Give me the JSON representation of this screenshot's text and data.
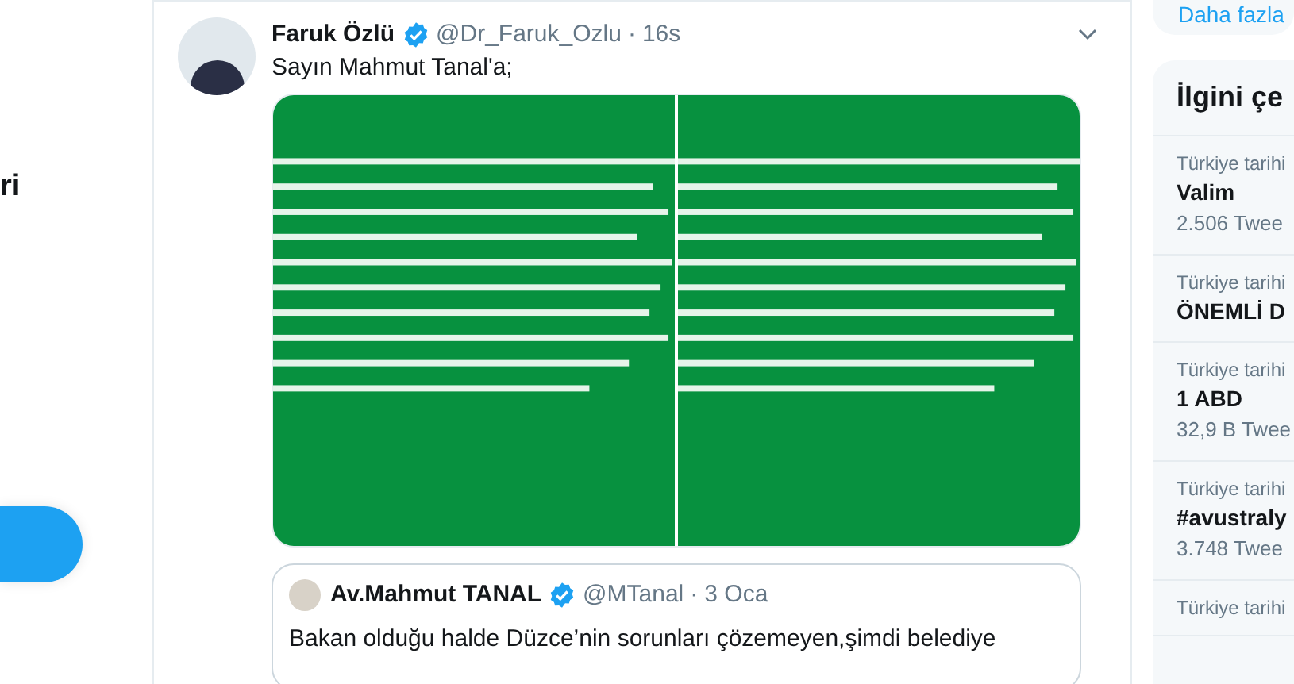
{
  "nav": {
    "label_fragment": "ri"
  },
  "tweet": {
    "name": "Faruk Özlü",
    "verified": true,
    "handle": "@Dr_Faruk_Ozlu",
    "separator": "·",
    "time": "16s",
    "text": "Sayın Mahmut Tanal'a;",
    "quote": {
      "name": "Av.Mahmut TANAL",
      "verified": true,
      "handle": "@MTanal",
      "separator": "·",
      "time": "3 Oca",
      "text": "Bakan olduğu halde Düzce’nin sorunları çözemeyen,şimdi belediye"
    }
  },
  "sidebar": {
    "more_link": "Daha fazla",
    "trends_title": "İlgini çe",
    "trends": [
      {
        "context": "Türkiye tarihi",
        "name": "Valim",
        "count": "2.506 Twee"
      },
      {
        "context": "Türkiye tarihi",
        "name": "ÖNEMLİ D"
      },
      {
        "context": "Türkiye tarihi",
        "name": "1 ABD",
        "count": "32,9 B Twee"
      },
      {
        "context": "Türkiye tarihi",
        "name": "#avustraly",
        "count": "3.748 Twee"
      },
      {
        "context": "Türkiye tarihi"
      }
    ]
  }
}
